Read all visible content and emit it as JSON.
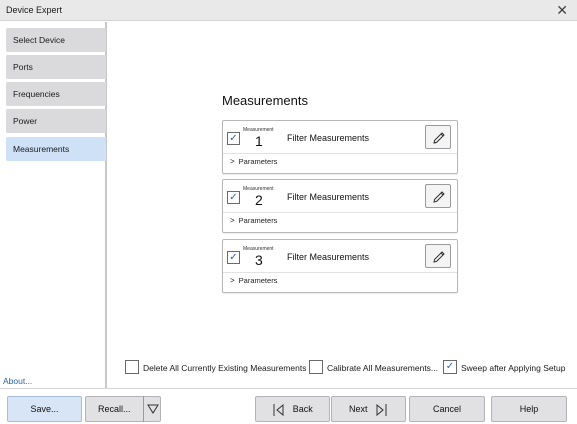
{
  "window": {
    "title": "Device Expert",
    "close_icon": "close-icon"
  },
  "sidebar": {
    "items": [
      {
        "label": "Select Device",
        "active": false
      },
      {
        "label": "Ports",
        "active": false
      },
      {
        "label": "Frequencies",
        "active": false
      },
      {
        "label": "Power",
        "active": false
      },
      {
        "label": "Measurements",
        "active": true
      }
    ],
    "about": "About..."
  },
  "main": {
    "title": "Measurements",
    "measurements": [
      {
        "caption": "Measurement",
        "number": "1",
        "name": "Filter Measurements",
        "checked": true,
        "params_label": "Parameters"
      },
      {
        "caption": "Measurement",
        "number": "2",
        "name": "Filter Measurements",
        "checked": true,
        "params_label": "Parameters"
      },
      {
        "caption": "Measurement",
        "number": "3",
        "name": "Filter Measurements",
        "checked": true,
        "params_label": "Parameters"
      }
    ]
  },
  "options": {
    "delete_all": {
      "label": "Delete All Currently Existing Measurements",
      "checked": false
    },
    "calibrate_all": {
      "label": "Calibrate All Measurements...",
      "checked": false
    },
    "sweep_after": {
      "label": "Sweep after Applying Setup",
      "checked": true
    }
  },
  "footer": {
    "save": "Save...",
    "recall": "Recall...",
    "back": "Back",
    "next": "Next",
    "cancel": "Cancel",
    "help": "Help"
  },
  "colors": {
    "accent": "#2a62b8",
    "active_nav": "#cfe1f7",
    "nav_bg": "#dadadc",
    "save_bg": "#d8e5f6"
  }
}
